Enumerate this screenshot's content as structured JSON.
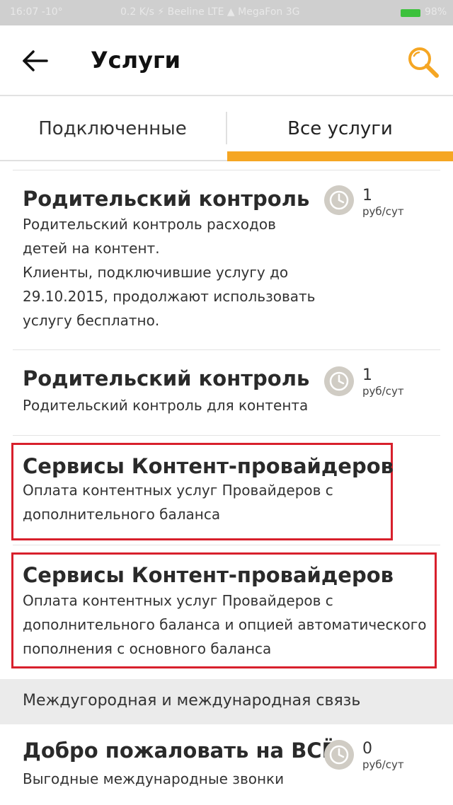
{
  "status_bar": {
    "time_temp": "16:07  -10°",
    "network": "0.2 K/s  ⚡  Beeline LTE  ▲  MegaFon 3G",
    "battery": "98%"
  },
  "app_bar": {
    "title": "Услуги"
  },
  "tabs": [
    {
      "label": "Подключенные",
      "active": false
    },
    {
      "label": "Все услуги",
      "active": true
    }
  ],
  "services": [
    {
      "title": "Родительский контроль",
      "desc": [
        "Родительский контроль расходов",
        "детей на контент.",
        "Клиенты, подключившие услугу до",
        "29.10.2015, продолжают использовать",
        "услугу бесплатно."
      ],
      "price": "1",
      "unit": "руб/сут"
    },
    {
      "title": "Родительский контроль",
      "desc": [
        "Родительский контроль для контента"
      ],
      "price": "1",
      "unit": "руб/сут"
    },
    {
      "title": "Сервисы Контент-провайдеров",
      "desc": [
        "Оплата контентных услуг Провайдеров с",
        "дополнительного баланса"
      ]
    },
    {
      "title": "Сервисы Контент-провайдеров",
      "desc": [
        "Оплата контентных услуг Провайдеров с",
        "дополнительного баланса и опцией автоматического",
        "пополнения с основного баланса"
      ]
    }
  ],
  "section_header": "Междугородная и международная связь",
  "section_services": [
    {
      "title": "Добро пожаловать на ВСЁ",
      "desc": [
        "Выгодные международные звонки"
      ],
      "price": "0",
      "unit": "руб/сут"
    }
  ],
  "colors": {
    "accent": "#f5a623",
    "highlight": "#d8202c"
  }
}
